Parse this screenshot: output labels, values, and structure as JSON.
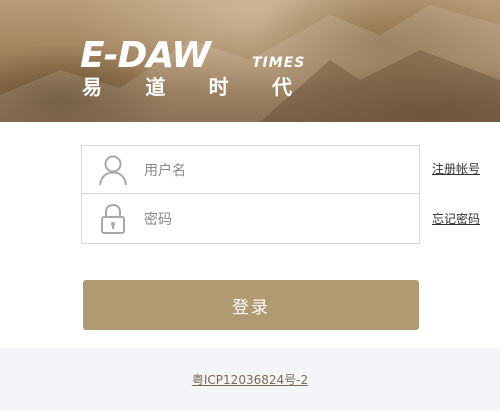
{
  "brand": {
    "logo_main": "E-DAW",
    "logo_suffix": "TIMES",
    "logo_cn_chars": [
      "易",
      "道",
      "时",
      "代"
    ]
  },
  "form": {
    "username_placeholder": "用户名",
    "password_placeholder": "密码",
    "register_link": "注册帐号",
    "forgot_link": "忘记密码",
    "login_button": "登录"
  },
  "footer": {
    "icp": "粤ICP12036824号-2"
  },
  "colors": {
    "accent": "#b09a72",
    "footer_bg": "#f4f5f9",
    "border": "#d9d9d9"
  },
  "icons": {
    "username": "user-icon",
    "password": "lock-icon"
  }
}
